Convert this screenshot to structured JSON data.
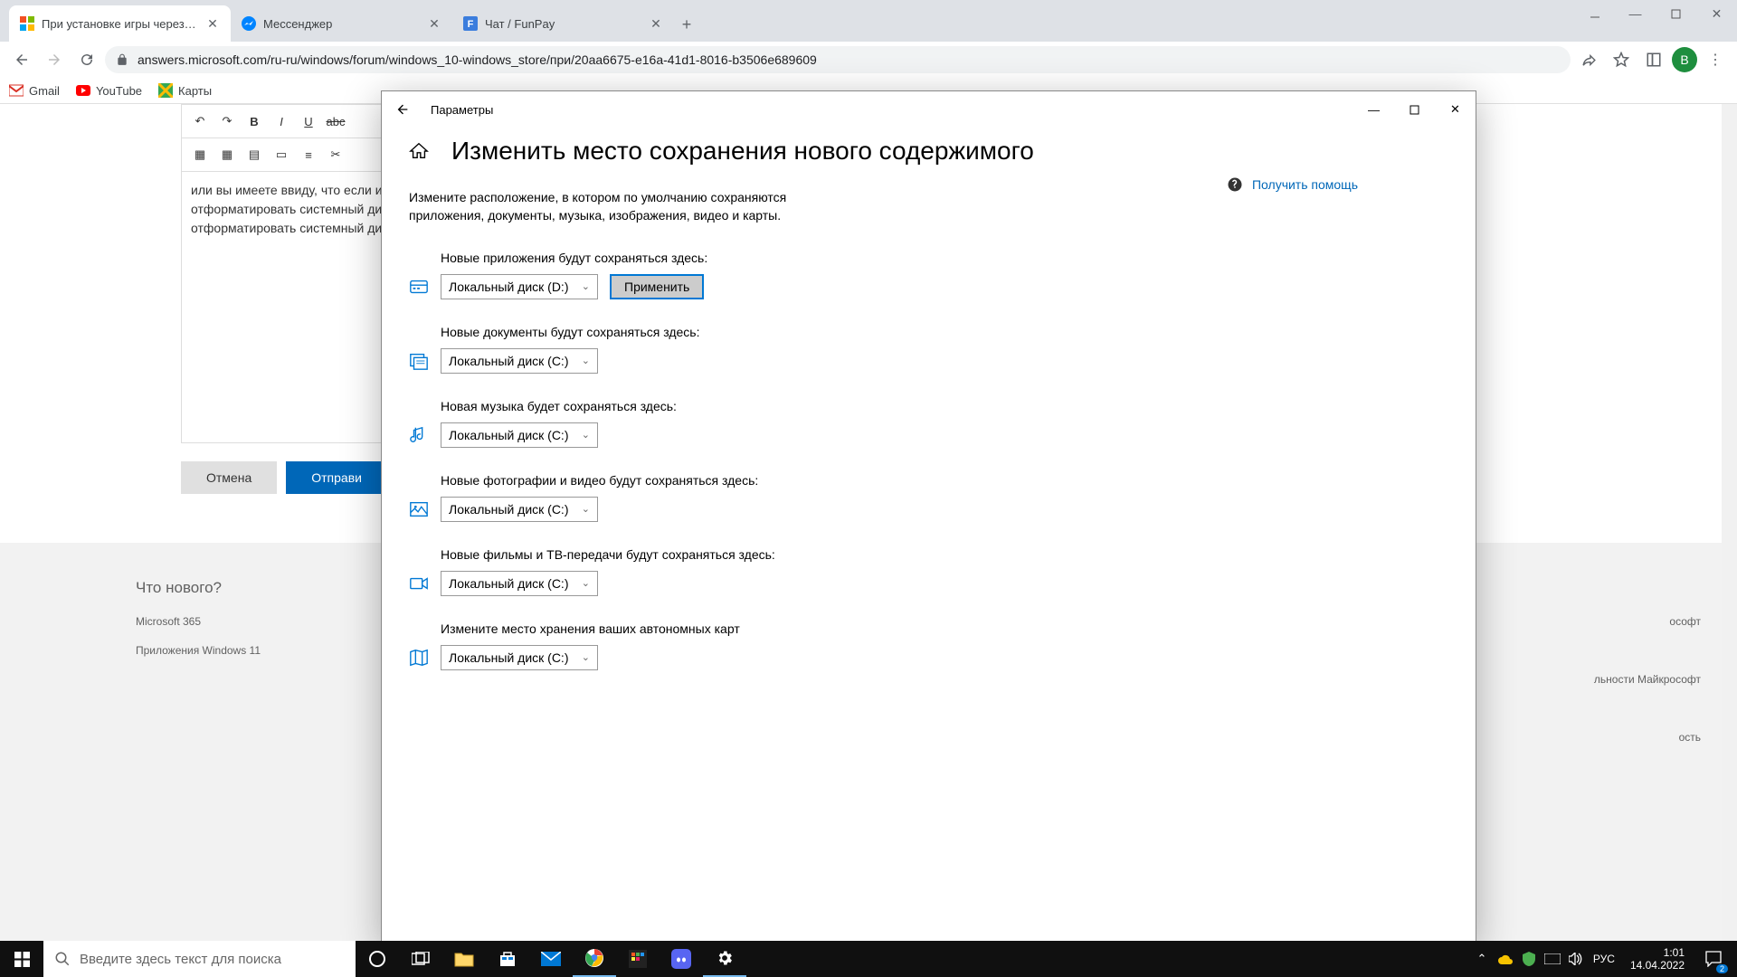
{
  "browser": {
    "tabs": [
      {
        "title": "При установке игры через май",
        "active": true
      },
      {
        "title": "Мессенджер",
        "active": false
      },
      {
        "title": "Чат / FunPay",
        "active": false
      }
    ],
    "url": "answers.microsoft.com/ru-ru/windows/forum/windows_10-windows_store/при/20aa6675-e16a-41d1-8016-b3506e689609",
    "bookmarks": [
      {
        "label": "Gmail"
      },
      {
        "label": "YouTube"
      },
      {
        "label": "Карты"
      }
    ],
    "avatar_letter": "В"
  },
  "page": {
    "editor_text_1": "или вы имеете ввиду, что если и",
    "editor_text_2": "отформатировать системный ди",
    "editor_text_3": "отформатировать системный ди",
    "cancel": "Отмена",
    "submit": "Отправи",
    "footer_heading": "Что нового?",
    "footer_link_1": "Microsoft 365",
    "footer_link_2": "Приложения Windows 11",
    "footer_right_1": "ософт",
    "footer_right_2": "льности Майкрософт",
    "footer_right_3": "ость"
  },
  "settings": {
    "window_title": "Параметры",
    "page_title": "Изменить место сохранения нового содержимого",
    "description": "Измените расположение, в котором по умолчанию сохраняются приложения, документы, музыка, изображения, видео и карты.",
    "help_link": "Получить помощь",
    "apply": "Применить",
    "sections": [
      {
        "label": "Новые приложения будут сохраняться здесь:",
        "value": "Локальный диск (D:)",
        "show_apply": true
      },
      {
        "label": "Новые документы будут сохраняться здесь:",
        "value": "Локальный диск (C:)",
        "show_apply": false
      },
      {
        "label": "Новая музыка будет сохраняться здесь:",
        "value": "Локальный диск (C:)",
        "show_apply": false
      },
      {
        "label": "Новые фотографии и видео будут сохраняться здесь:",
        "value": "Локальный диск (C:)",
        "show_apply": false
      },
      {
        "label": "Новые фильмы и ТВ-передачи будут сохраняться здесь:",
        "value": "Локальный диск (C:)",
        "show_apply": false
      },
      {
        "label": "Измените место хранения ваших автономных карт",
        "value": "Локальный диск (C:)",
        "show_apply": false
      }
    ]
  },
  "taskbar": {
    "search_placeholder": "Введите здесь текст для поиска",
    "lang": "РУС",
    "time": "1:01",
    "date": "14.04.2022",
    "notif_count": "2"
  }
}
